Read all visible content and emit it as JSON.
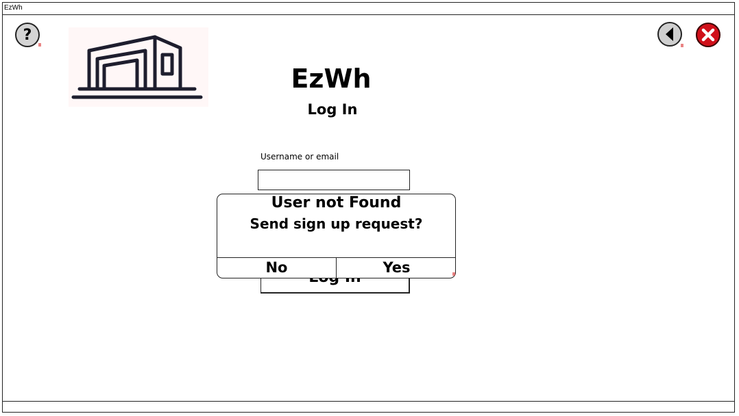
{
  "window": {
    "title": "EzWh"
  },
  "header": {
    "help_icon_glyph": "?",
    "app_title": "EzWh",
    "page_title": "Log In"
  },
  "form": {
    "username_label": "Username or email",
    "username_value": "",
    "login_button_label": "Log In"
  },
  "dialog": {
    "line1": "User not Found",
    "line2": "Send sign up request?",
    "no_label": "No",
    "yes_label": "Yes"
  },
  "icons": {
    "help": "help-icon",
    "back": "back-arrow-icon",
    "close": "close-icon",
    "logo": "warehouse-logo-icon"
  },
  "colors": {
    "close_button": "#d0101a",
    "logo_background": "#fff7f7"
  }
}
